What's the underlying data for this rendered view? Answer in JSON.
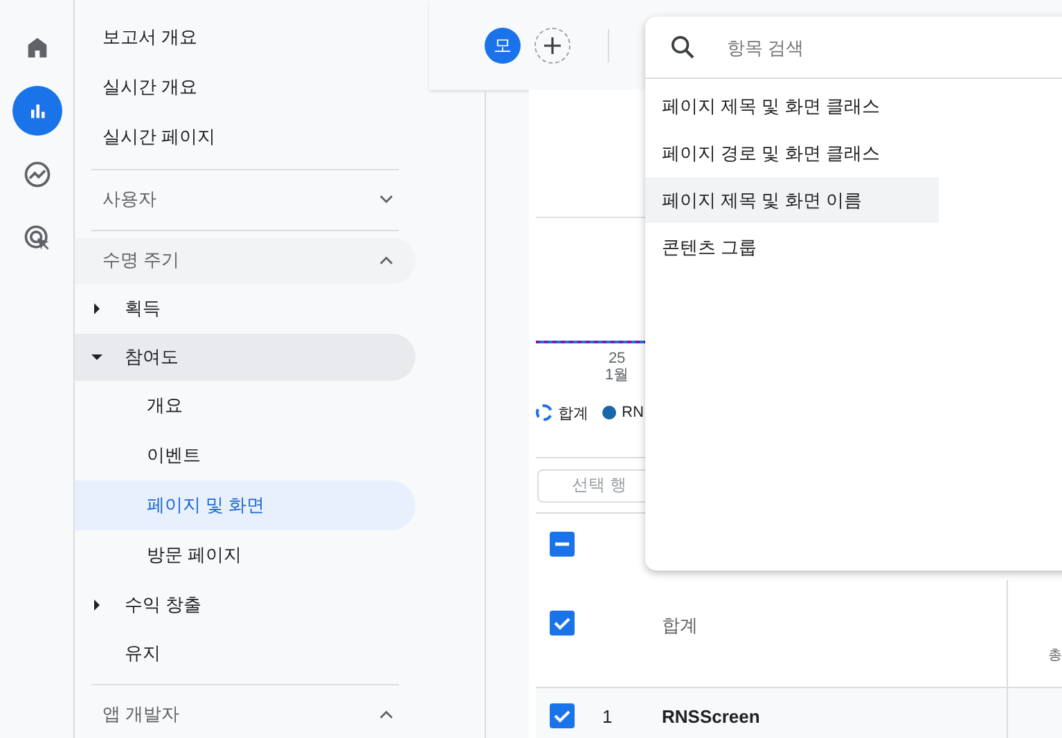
{
  "rail": [
    {
      "kind": "home",
      "selected": false
    },
    {
      "kind": "reports",
      "selected": true
    },
    {
      "kind": "explore",
      "selected": false
    },
    {
      "kind": "advertising",
      "selected": false
    }
  ],
  "nav": [
    {
      "kind": "link",
      "label": "보고서 개요"
    },
    {
      "kind": "link",
      "label": "실시간 개요"
    },
    {
      "kind": "link",
      "label": "실시간 페이지"
    },
    {
      "kind": "section",
      "label": "사용자",
      "expanded": false
    },
    {
      "kind": "section",
      "label": "수명 주기",
      "expanded": true,
      "children": [
        {
          "kind": "group",
          "label": "획득",
          "expanded": false
        },
        {
          "kind": "group",
          "label": "참여도",
          "expanded": true,
          "children": [
            {
              "label": "개요",
              "selected": false
            },
            {
              "label": "이벤트",
              "selected": false
            },
            {
              "label": "페이지 및 화면",
              "selected": true
            },
            {
              "label": "방문 페이지",
              "selected": false
            }
          ]
        },
        {
          "kind": "group",
          "label": "수익 창출",
          "expanded": false
        },
        {
          "kind": "link",
          "label": "유지"
        }
      ]
    },
    {
      "kind": "section",
      "label": "앱 개발자",
      "expanded": true
    }
  ],
  "header": {
    "avatar": "모"
  },
  "chart": {
    "x_label": "25",
    "x_sublabel": "1월"
  },
  "legend": [
    {
      "kind": "total",
      "label": "합계",
      "color": "#1a73e8"
    },
    {
      "kind": "series",
      "label": "RN",
      "color": "#1967a8"
    }
  ],
  "action_button": "선택 행",
  "table": {
    "header_checkbox": {
      "indeterminate": true
    },
    "rows": [
      {
        "kind": "total",
        "checked": true,
        "label": "합계",
        "column_3": "총"
      },
      {
        "kind": "row",
        "checked": true,
        "index": "1",
        "label": "RNSScreen"
      }
    ]
  },
  "dropdown": {
    "search": {
      "placeholder": "항목 검색"
    },
    "items": [
      {
        "label": "페이지 제목 및 화면 클래스",
        "selected": false
      },
      {
        "label": "페이지 경로 및 화면 클래스",
        "selected": false
      },
      {
        "label": "페이지 제목 및 화면 이름",
        "selected": true
      },
      {
        "label": "콘텐츠 그룹",
        "selected": false
      }
    ]
  }
}
